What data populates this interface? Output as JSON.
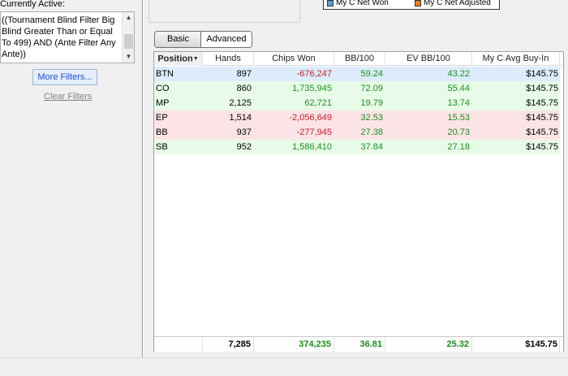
{
  "filters": {
    "active_label": "Currently Active:",
    "text": "((Tournament Blind Filter Big Blind Greater Than or Equal To 499) AND (Ante Filter Any Ante))",
    "more_filters_label": "More Filters...",
    "clear_filters_label": "Clear Filters"
  },
  "legend": {
    "items": [
      {
        "label": "My C Net Won",
        "color": "#5b9bd5"
      },
      {
        "label": "My C Net Adjusted",
        "color": "#f07d20"
      }
    ]
  },
  "tabs": [
    {
      "label": "Basic",
      "active": true
    },
    {
      "label": "Advanced",
      "active": false
    }
  ],
  "columns": [
    "Position",
    "Hands",
    "Chips Won",
    "BB/100",
    "EV BB/100",
    "My C Avg Buy-In"
  ],
  "rows": [
    {
      "position": "BTN",
      "hands": "897",
      "chips_won": "-676,247",
      "bb100": "59.24",
      "ev_bb100": "43.22",
      "avg_buyin": "$145.75"
    },
    {
      "position": "CO",
      "hands": "860",
      "chips_won": "1,735,945",
      "bb100": "72.09",
      "ev_bb100": "55.44",
      "avg_buyin": "$145.75"
    },
    {
      "position": "MP",
      "hands": "2,125",
      "chips_won": "62,721",
      "bb100": "19.79",
      "ev_bb100": "13.74",
      "avg_buyin": "$145.75"
    },
    {
      "position": "EP",
      "hands": "1,514",
      "chips_won": "-2,056,649",
      "bb100": "32.53",
      "ev_bb100": "15.53",
      "avg_buyin": "$145.75"
    },
    {
      "position": "BB",
      "hands": "937",
      "chips_won": "-277,945",
      "bb100": "27.38",
      "ev_bb100": "20.73",
      "avg_buyin": "$145.75"
    },
    {
      "position": "SB",
      "hands": "952",
      "chips_won": "1,586,410",
      "bb100": "37.84",
      "ev_bb100": "27.18",
      "avg_buyin": "$145.75"
    }
  ],
  "totals": {
    "hands": "7,285",
    "chips_won": "374,235",
    "bb100": "36.81",
    "ev_bb100": "25.32",
    "avg_buyin": "$145.75"
  }
}
